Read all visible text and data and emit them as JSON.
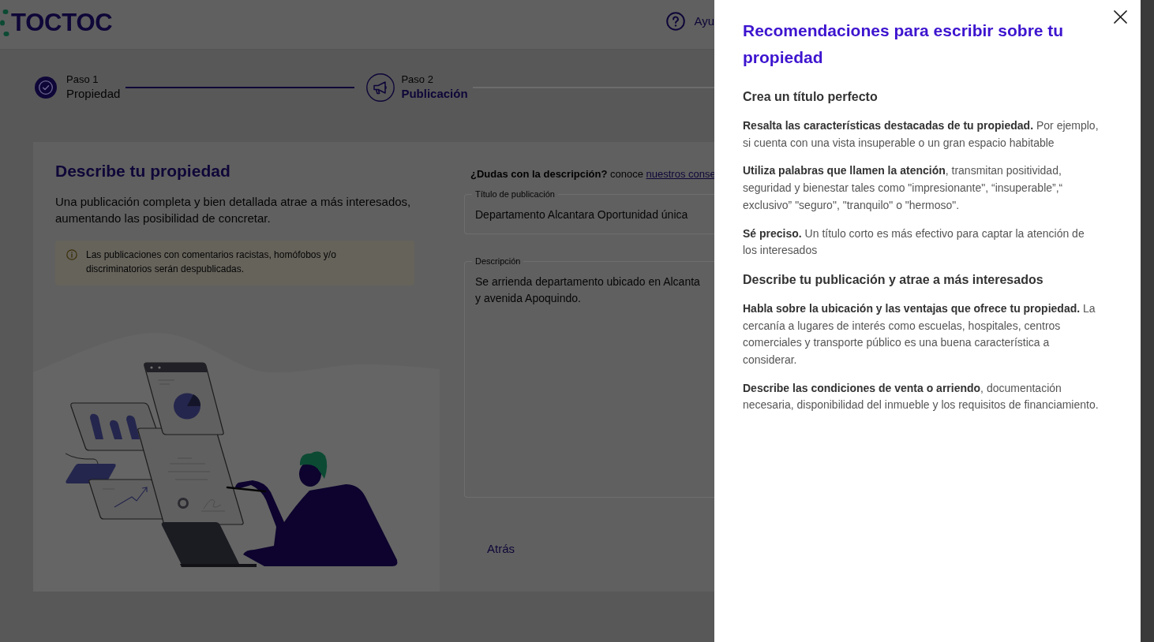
{
  "header": {
    "logo": "TOCTOC",
    "help_button": "Ayu"
  },
  "steps": [
    {
      "label": "Paso 1",
      "title": "Propiedad",
      "completed": true,
      "selected": false
    },
    {
      "label": "Paso 2",
      "title": "Publicación",
      "completed": false,
      "selected": true
    }
  ],
  "intro": {
    "title": "Describe tu propiedad",
    "description": "Una publicación completa y bien detallada atrae a más interesados, aumentando las posibilidad de concretar.",
    "notice": "Las publicaciones con comentarios racistas, homófobos y/o discriminatorios serán despublicadas."
  },
  "form": {
    "help_text": "**¿Dudas con la descripción?** conoce",
    "help_link": "nuestros conse",
    "fields": [
      {
        "kind": "input",
        "label": "Título de publicación",
        "value": "Departamento Alcantara Oportunidad única"
      },
      {
        "kind": "textarea",
        "label": "Descripción",
        "value": "Se arrienda departamento ubicado en Alcanta\ny avenida Apoquindo."
      }
    ],
    "back_button": "Atrás"
  },
  "drawer": {
    "title": "Recomendaciones para escribir sobre tu propiedad",
    "sections": [
      {
        "heading": "Crea un título perfecto",
        "tips": [
          "**Resalta las características destacadas de tu propiedad.** Por ejemplo, si cuenta con una vista insuperable o un gran espacio habitable",
          "**Utiliza palabras que llamen la atención**, transmitan positividad, seguridad y bienestar tales como \"impresionante\", “insuperable”,“ exclusivo” \"seguro\", \"tranquilo\" o \"hermoso\".",
          "**Sé preciso.** Un título corto es más efectivo para captar la atención de los interesados"
        ]
      },
      {
        "heading": "Describe tu publicación y atrae a más interesados",
        "tips": [
          "**Habla sobre la ubicación y las ventajas que ofrece tu propiedad.** La cercanía a lugares de interés como escuelas, hospitales, centros comerciales y transporte público es una buena característica a considerar.",
          "**Describe las condiciones de venta o arriendo**, documentación necesaria, disponibilidad del inmueble y los requisitos de financiamiento."
        ]
      }
    ]
  }
}
